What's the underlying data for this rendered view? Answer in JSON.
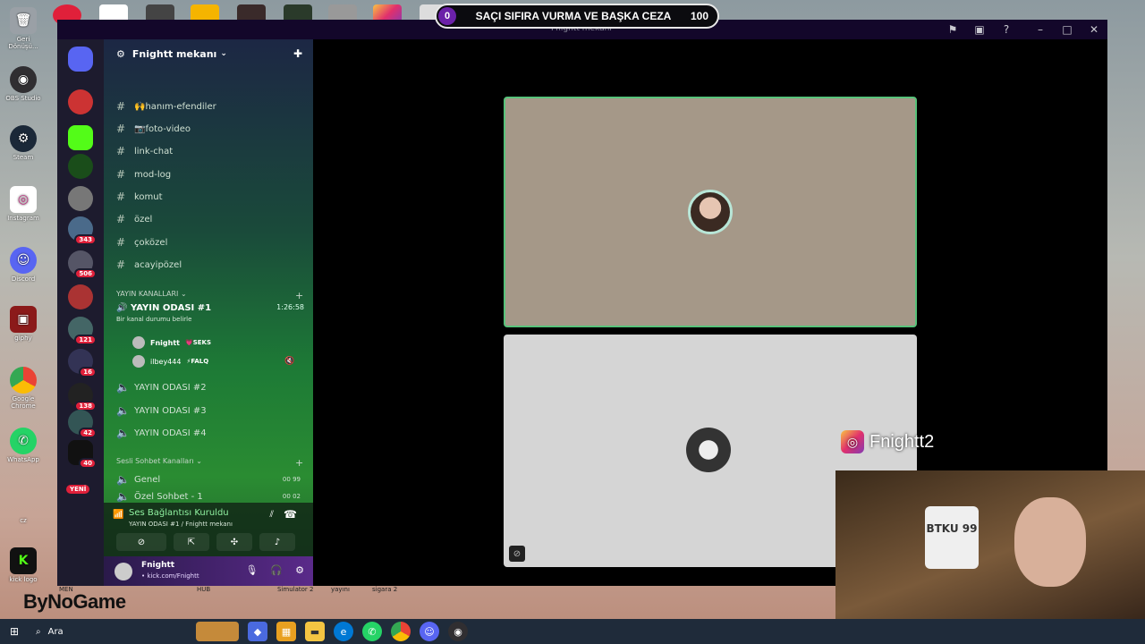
{
  "banner": {
    "left_value": "0",
    "text": "SAÇI SIFIRA VURMA VE BAŞKA CEZA",
    "right_value": "100"
  },
  "window": {
    "title": "Fnightt mekanı"
  },
  "desktop_icons": [
    {
      "label": "Geri Dönüşü...",
      "color": "#9aa0a6"
    },
    {
      "label": "OBS Studio",
      "color": "#302e31"
    },
    {
      "label": "Steam",
      "color": "#1b2838"
    },
    {
      "label": "Instagram",
      "color": "#c13584"
    },
    {
      "label": "Discord",
      "color": "#5865f2"
    },
    {
      "label": "giphy",
      "color": "#d01"
    },
    {
      "label": "Google Chrome",
      "color": "#4285f4"
    },
    {
      "label": "WhatsApp",
      "color": "#25d366"
    },
    {
      "label": "cz",
      "color": "#556"
    },
    {
      "label": "kick logo",
      "color": "#53fc18"
    }
  ],
  "server": {
    "name": "Fnightt mekanı"
  },
  "server_badges": [
    "343",
    "506",
    "121",
    "16",
    "138",
    "42",
    "40"
  ],
  "new_badge": "YENİ",
  "channels": [
    {
      "label": "🙌hanım-efendiler"
    },
    {
      "label": "📷foto-video"
    },
    {
      "label": "link-chat"
    },
    {
      "label": "mod-log"
    },
    {
      "label": "komut"
    },
    {
      "label": "özel"
    },
    {
      "label": "çoközel"
    },
    {
      "label": "acayipözel"
    }
  ],
  "categories": {
    "stream": "YAYIN KANALLARI",
    "voice": "Sesli Sohbet Kanalları"
  },
  "active_voice": {
    "name": "YAYIN ODASI #1",
    "time": "1:26:58",
    "status": "Bir kanal durumu belirle",
    "members": [
      {
        "name": "Fnightt",
        "tag": "💗SEKS"
      },
      {
        "name": "ilbey444",
        "tag": "⚡FALQ"
      }
    ]
  },
  "stream_rooms": [
    "YAYIN ODASI #2",
    "YAYIN ODASI #3",
    "YAYIN ODASI #4"
  ],
  "voice_rooms": [
    {
      "name": "Genel",
      "left": "00",
      "right": "99"
    },
    {
      "name": "Özel Sohbet - 1",
      "left": "00",
      "right": "02"
    }
  ],
  "voice_panel": {
    "title": "Ses Bağlantısı Kuruldu",
    "subtitle": "YAYIN ODASI #1 / Fnightt mekanı"
  },
  "user": {
    "name": "Fnightt",
    "status": "• kick.com/Fnightt"
  },
  "instagram_handle": "Fnightt2",
  "webcam_shirt": "BTKU 99",
  "bottom_labels": [
    "MEN",
    "HUB",
    "Simulator 2",
    "yayını",
    "sigara 2"
  ],
  "brand": "ByNoGame",
  "taskbar": {
    "search_placeholder": "Ara"
  },
  "accent_green": "#57c27a"
}
